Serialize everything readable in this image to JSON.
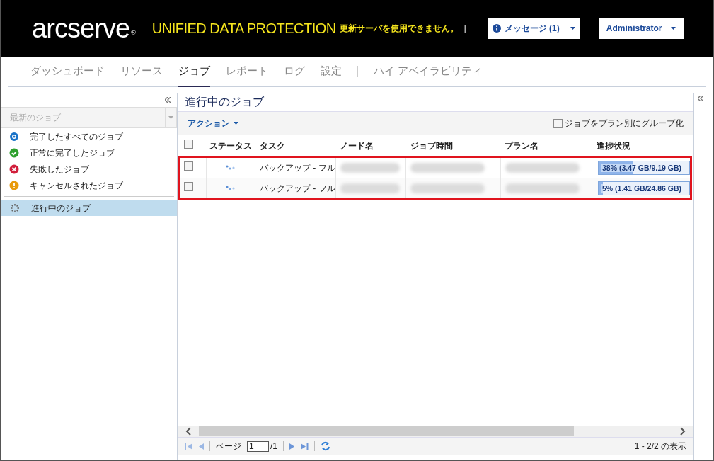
{
  "header": {
    "logo": "arcserve",
    "logo_mark": "®",
    "product": "UNIFIED DATA PROTECTION",
    "update_notice": "更新サーバを使用できません。",
    "separator": "|",
    "messages_button": "メッセージ (1)",
    "user_button": "Administrator"
  },
  "nav": [
    {
      "label": "ダッシュボード",
      "selected": false
    },
    {
      "label": "リソース",
      "selected": false
    },
    {
      "label": "ジョブ",
      "selected": true
    },
    {
      "label": "レポート",
      "selected": false
    },
    {
      "label": "ログ",
      "selected": false
    },
    {
      "label": "設定",
      "selected": false
    },
    {
      "label": "ハイ アベイラビリティ",
      "selected": false
    }
  ],
  "sidebar": {
    "filter_placeholder": "最新のジョブ",
    "items": [
      {
        "label": "完了したすべてのジョブ",
        "kind": "all",
        "selected": false
      },
      {
        "label": "正常に完了したジョブ",
        "kind": "success",
        "selected": false
      },
      {
        "label": "失敗したジョブ",
        "kind": "failed",
        "selected": false
      },
      {
        "label": "キャンセルされたジョブ",
        "kind": "canceled",
        "selected": false
      },
      {
        "label": "進行中のジョブ",
        "kind": "running",
        "selected": true
      }
    ]
  },
  "main": {
    "title": "進行中のジョブ",
    "action_menu": "アクション",
    "group_by_plan": {
      "label": "ジョブをプラン別にグループ化",
      "checked": false
    },
    "table": {
      "columns": [
        "ステータス",
        "タスク",
        "ノード名",
        "ジョブ時間",
        "プラン名",
        "進捗状況"
      ],
      "all_checked": false,
      "rows": [
        {
          "checked": false,
          "task": "バックアップ - フル",
          "progress": "38% (3.47 GB/9.19 GB)",
          "level": 0.38
        },
        {
          "checked": false,
          "task": "バックアップ - フル",
          "progress": "5% (1.41 GB/24.86 GB)",
          "level": 0.05
        }
      ]
    },
    "pager": {
      "page_label": "ページ",
      "page": "1",
      "page_total": "/1",
      "summary": "1 - 2/2 の表示"
    }
  }
}
